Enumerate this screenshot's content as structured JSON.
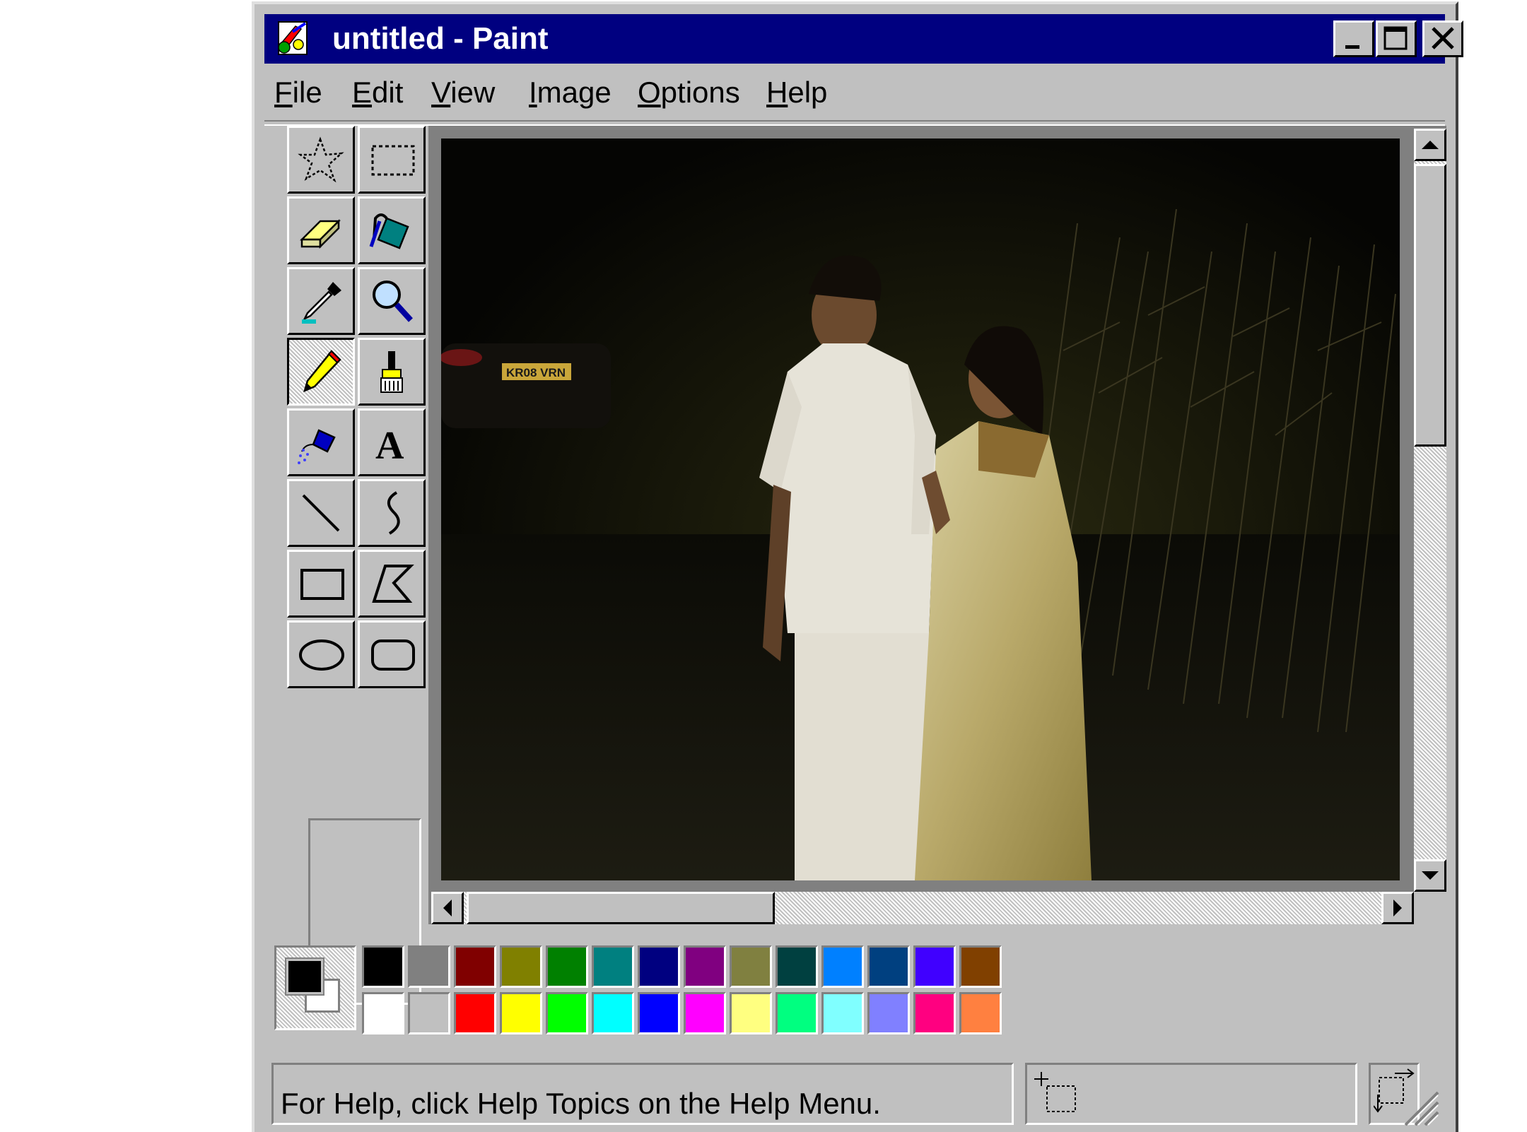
{
  "window": {
    "title": "untitled - Paint",
    "title_bar_color": "#000080",
    "caption_buttons": [
      "minimize-icon",
      "maximize-icon",
      "close-icon"
    ]
  },
  "menu": {
    "items": [
      {
        "label": "File",
        "accel": "F"
      },
      {
        "label": "Edit",
        "accel": "E"
      },
      {
        "label": "View",
        "accel": "V"
      },
      {
        "label": "Image",
        "accel": "I"
      },
      {
        "label": "Options",
        "accel": "O"
      },
      {
        "label": "Help",
        "accel": "H"
      }
    ]
  },
  "toolbox": {
    "tools": [
      {
        "name": "free-form-select",
        "icon": "free-form-select-icon"
      },
      {
        "name": "select",
        "icon": "rectangle-select-icon"
      },
      {
        "name": "eraser",
        "icon": "eraser-icon"
      },
      {
        "name": "fill-with-color",
        "icon": "paint-bucket-icon"
      },
      {
        "name": "pick-color",
        "icon": "eyedropper-icon"
      },
      {
        "name": "magnifier",
        "icon": "magnifier-icon"
      },
      {
        "name": "pencil",
        "icon": "pencil-icon"
      },
      {
        "name": "brush",
        "icon": "brush-icon"
      },
      {
        "name": "airbrush",
        "icon": "airbrush-icon"
      },
      {
        "name": "text",
        "icon": "text-icon"
      },
      {
        "name": "line",
        "icon": "line-icon"
      },
      {
        "name": "curve",
        "icon": "curve-icon"
      },
      {
        "name": "rectangle",
        "icon": "rectangle-icon"
      },
      {
        "name": "polygon",
        "icon": "polygon-icon"
      },
      {
        "name": "ellipse",
        "icon": "ellipse-icon"
      },
      {
        "name": "rounded-rectangle",
        "icon": "rounded-rectangle-icon"
      }
    ],
    "active_tool": "pencil",
    "text_tool_glyph": "A"
  },
  "canvas": {
    "image_content": "night photo: man in white shirt and dhoti beside woman in gold saree, looking up; dark trees and a car in background",
    "license_plate": "KR08 VRN"
  },
  "scrollbars": {
    "vertical_position": 0.0,
    "horizontal_position": 0.0
  },
  "palette": {
    "foreground": "#000000",
    "background": "#ffffff",
    "row1": [
      "#000000",
      "#808080",
      "#800000",
      "#808000",
      "#008000",
      "#008080",
      "#000080",
      "#800080",
      "#808040",
      "#004040",
      "#0080ff",
      "#004080",
      "#4000ff",
      "#804000"
    ],
    "row2": [
      "#ffffff",
      "#c0c0c0",
      "#ff0000",
      "#ffff00",
      "#00ff00",
      "#00ffff",
      "#0000ff",
      "#ff00ff",
      "#ffff80",
      "#00ff80",
      "#80ffff",
      "#8080ff",
      "#ff0080",
      "#ff8040"
    ]
  },
  "status": {
    "help_text": "For Help, click Help Topics on the Help Menu."
  }
}
